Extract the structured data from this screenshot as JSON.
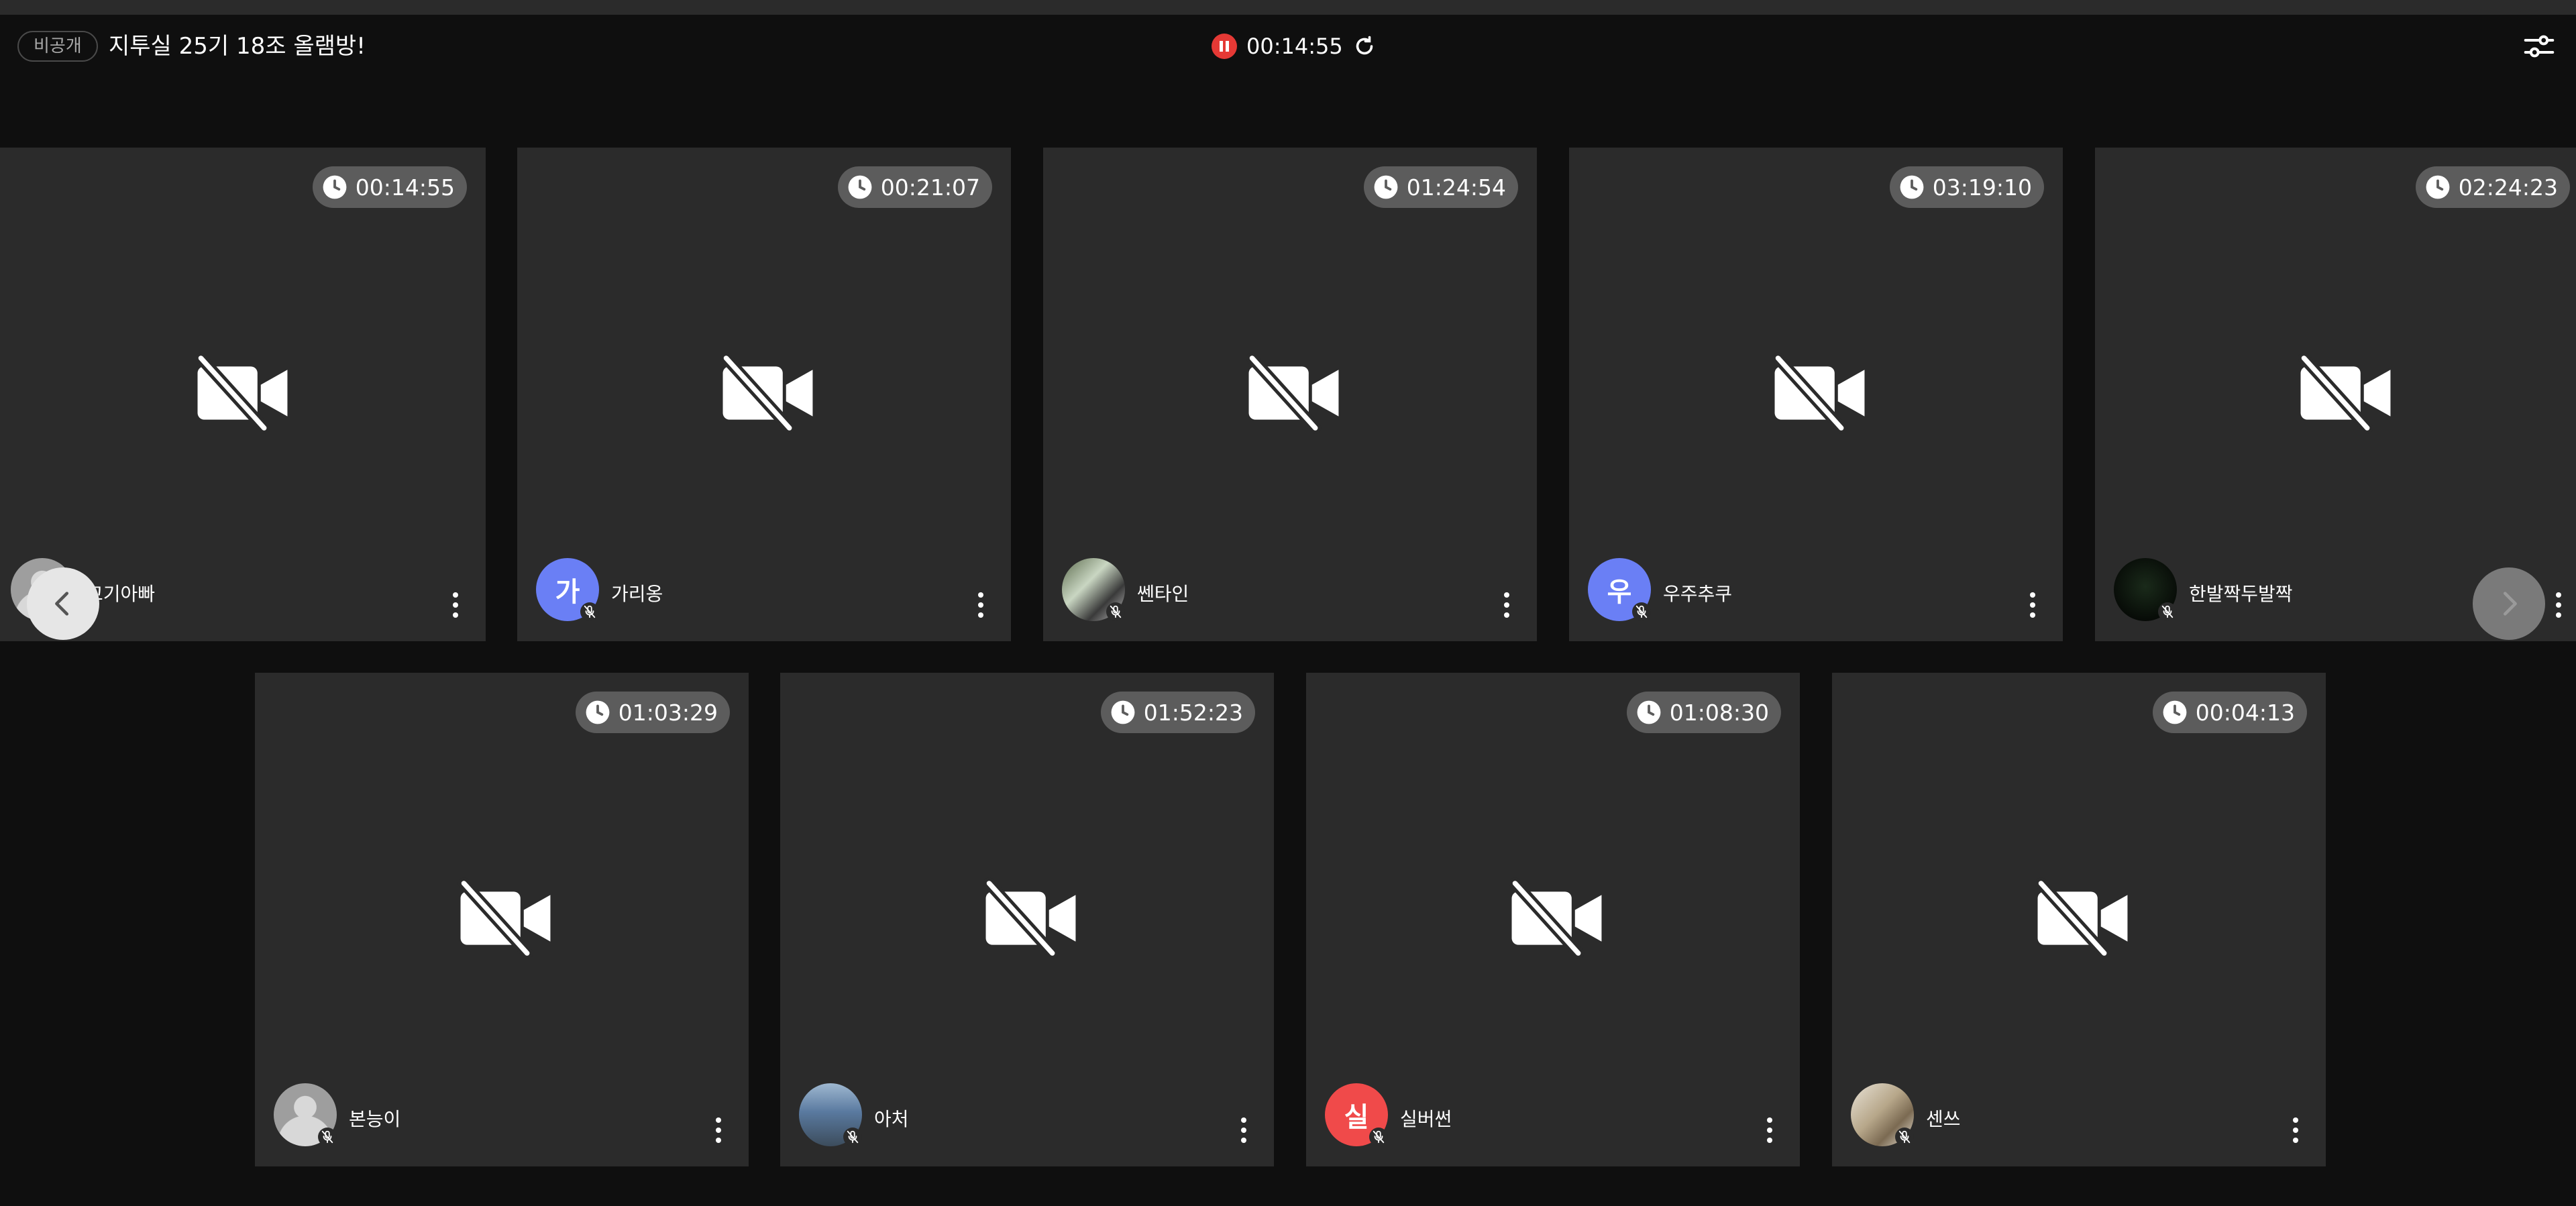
{
  "header": {
    "visibility_badge": "비공개",
    "room_title": "지투실 25기 18조 올램방!",
    "session_timer": "00:14:55",
    "icons": [
      "pause-icon",
      "refresh-icon",
      "settings-sliders-icon"
    ]
  },
  "colors": {
    "background": "#0f0f0f",
    "tile": "#2b2b2b",
    "timer_pill": "#5c5c5c",
    "recording_red": "#e53935",
    "avatar_blue": "#6a7ff5",
    "avatar_red": "#f04a4a"
  },
  "participants": [
    {
      "name": "꼬기아빠",
      "time": "00:14:55",
      "avatar_type": "photo-default",
      "avatar_text": ""
    },
    {
      "name": "가리옹",
      "time": "00:21:07",
      "avatar_type": "initial",
      "avatar_text": "가"
    },
    {
      "name": "쎈타인",
      "time": "01:24:54",
      "avatar_type": "photo",
      "avatar_text": ""
    },
    {
      "name": "우주추쿠",
      "time": "03:19:10",
      "avatar_type": "initial",
      "avatar_text": "우"
    },
    {
      "name": "한발짝두발짝",
      "time": "02:24:23",
      "avatar_type": "photo",
      "avatar_text": ""
    },
    {
      "name": "본능이",
      "time": "01:03:29",
      "avatar_type": "photo-default",
      "avatar_text": ""
    },
    {
      "name": "아처",
      "time": "01:52:23",
      "avatar_type": "photo",
      "avatar_text": ""
    },
    {
      "name": "실버썬",
      "time": "01:08:30",
      "avatar_type": "initial",
      "avatar_text": "실"
    },
    {
      "name": "센쓰",
      "time": "00:04:13",
      "avatar_type": "photo",
      "avatar_text": ""
    }
  ],
  "navigation": {
    "prev_icon": "chevron-left-icon",
    "next_icon": "chevron-right-icon"
  }
}
